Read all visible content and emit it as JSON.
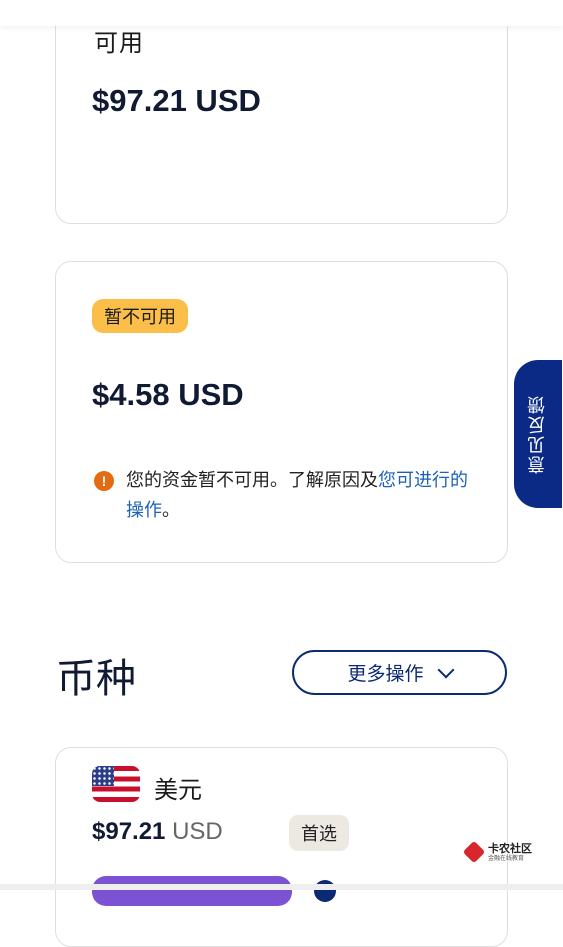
{
  "balance_card": {
    "label": "可用",
    "amount": "$97.21 USD"
  },
  "unavailable_card": {
    "badge": "暂不可用",
    "amount": "$4.58 USD",
    "notice_text": "您的资金暂不可用。了解原因及",
    "notice_link": "您可进行的操作",
    "notice_end": "。"
  },
  "currency_section": {
    "title": "币种",
    "more_button": "更多操作"
  },
  "currency_item": {
    "name": "美元",
    "amount": "$97.21",
    "code": "USD",
    "badge": "首选"
  },
  "feedback_tab": "意见反馈",
  "watermark": {
    "title": "卡农社区",
    "subtitle": "金融在线教育"
  },
  "colors": {
    "primary_navy": "#0b2a72",
    "badge_yellow": "#fbbf49",
    "warning_orange": "#e46b12",
    "link_blue": "#1b62b5",
    "chip_purple": "#7b52d4"
  }
}
